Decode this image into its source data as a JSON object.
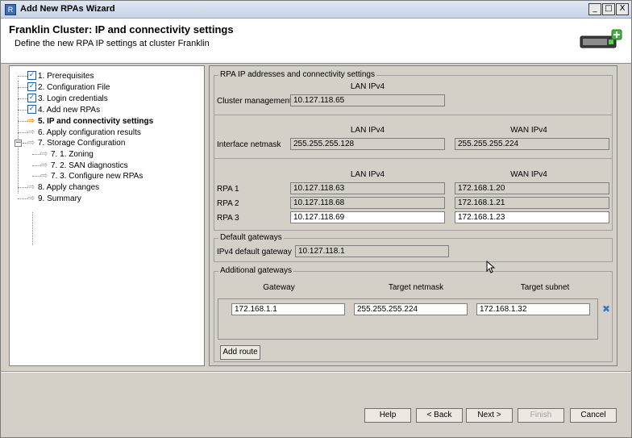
{
  "window": {
    "title": "Add New RPAs Wizard",
    "minimize": "_",
    "maximize": "□",
    "close": "X"
  },
  "header": {
    "title": "Franklin Cluster: IP and connectivity settings",
    "subtitle": "Define the new RPA IP settings at cluster Franklin"
  },
  "tree": {
    "items": [
      {
        "label": "1. Prerequisites",
        "state": "checked"
      },
      {
        "label": "2. Configuration File",
        "state": "checked"
      },
      {
        "label": "3. Login credentials",
        "state": "checked"
      },
      {
        "label": "4. Add new RPAs",
        "state": "checked"
      },
      {
        "label": "5. IP and connectivity settings",
        "state": "current"
      },
      {
        "label": "6. Apply configuration results",
        "state": "pending"
      },
      {
        "label": "7. Storage Configuration",
        "state": "pending"
      },
      {
        "label": "7. 1. Zoning",
        "state": "pending"
      },
      {
        "label": "7. 2. SAN diagnostics",
        "state": "pending"
      },
      {
        "label": "7. 3. Configure new RPAs",
        "state": "pending"
      },
      {
        "label": "8. Apply changes",
        "state": "pending"
      },
      {
        "label": "9. Summary",
        "state": "pending"
      }
    ],
    "check_glyph": "✓",
    "arrow_glyph": "⇨",
    "expander_glyph": "−"
  },
  "rpa_settings": {
    "group_title": "RPA IP addresses and connectivity settings",
    "lan_header": "LAN IPv4",
    "wan_header": "WAN IPv4",
    "cluster_management": {
      "label": "Cluster management",
      "lan": "10.127.118.65"
    },
    "interface_netmask": {
      "label": "Interface netmask",
      "lan": "255.255.255.128",
      "wan": "255.255.255.224"
    },
    "rpas": [
      {
        "label": "RPA 1",
        "lan": "10.127.118.63",
        "wan": "172.168.1.20"
      },
      {
        "label": "RPA 2",
        "lan": "10.127.118.68",
        "wan": "172.168.1.21"
      },
      {
        "label": "RPA 3",
        "lan": "10.127.118.69",
        "wan": "172.168.1.23"
      }
    ]
  },
  "default_gateways": {
    "group_title": "Default gateways",
    "label": "IPv4 default gateway",
    "value": "10.127.118.1"
  },
  "additional_gateways": {
    "group_title": "Additional gateways",
    "columns": [
      "Gateway",
      "Target netmask",
      "Target subnet"
    ],
    "routes": [
      {
        "gateway": "172.168.1.1",
        "netmask": "255.255.255.224",
        "subnet": "172.168.1.32"
      }
    ],
    "delete_glyph": "✖",
    "add_route_label": "Add route"
  },
  "footer": {
    "help": "Help",
    "back": "< Back",
    "next": "Next >",
    "finish": "Finish",
    "cancel": "Cancel"
  }
}
